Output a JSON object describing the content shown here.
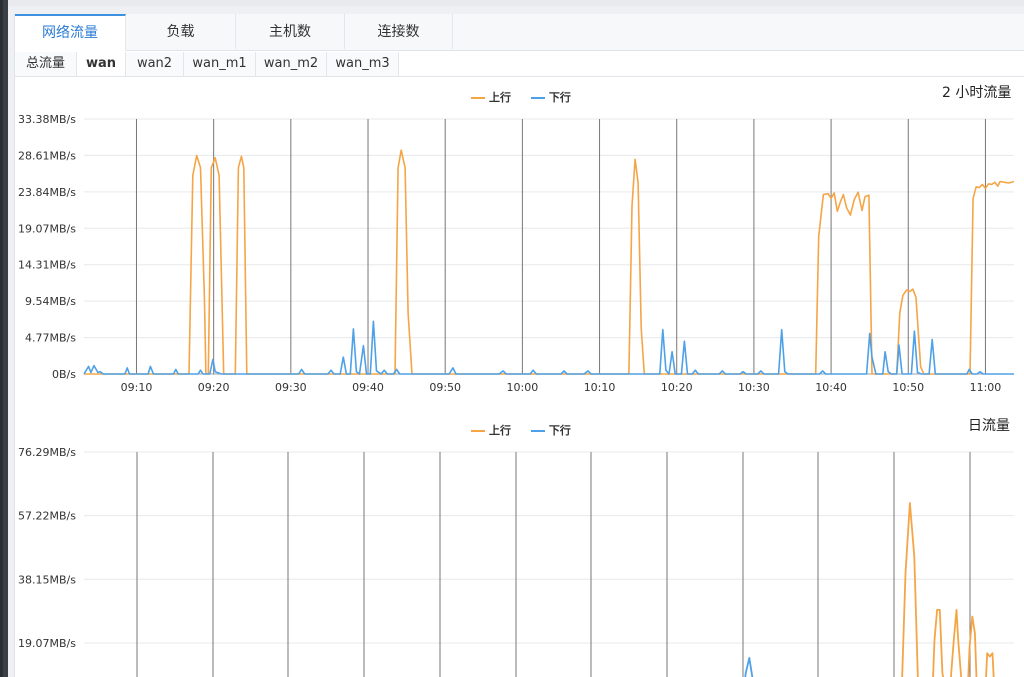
{
  "tabs": [
    "网络流量",
    "负载",
    "主机数",
    "连接数"
  ],
  "subtabs": [
    "总流量",
    "wan",
    "wan2",
    "wan_m1",
    "wan_m2",
    "wan_m3"
  ],
  "colors": {
    "up": "#f5a545",
    "down": "#4ea1e8",
    "accent": "#3d8fe0"
  },
  "legend": {
    "up": "上行",
    "down": "下行"
  },
  "chart_data": [
    {
      "type": "line",
      "title": "2 小时流量",
      "ylim": [
        0,
        33.38
      ],
      "y_ticks": [
        "0B/s",
        "4.77MB/s",
        "9.54MB/s",
        "14.31MB/s",
        "19.07MB/s",
        "23.84MB/s",
        "28.61MB/s",
        "33.38MB/s"
      ],
      "x_ticks": [
        "09:10",
        "09:20",
        "09:30",
        "09:40",
        "09:50",
        "10:00",
        "10:10",
        "10:20",
        "10:30",
        "10:40",
        "10:50",
        "11:00"
      ],
      "x_tick_minutes": [
        10,
        20,
        30,
        40,
        50,
        60,
        70,
        80,
        90,
        100,
        110,
        120
      ],
      "xlim_minutes": [
        3.2,
        123.7
      ],
      "series": [
        {
          "name": "上行",
          "color": "#f5a545",
          "x": [
            3.2,
            16.8,
            17.3,
            17.8,
            18.3,
            18.8,
            19.0,
            19.3,
            19.7,
            20.2,
            20.7,
            21.3,
            22.8,
            23.2,
            23.6,
            23.9,
            24.3,
            43.5,
            43.9,
            44.3,
            44.8,
            45.2,
            45.7,
            46.5,
            73.8,
            74.2,
            74.6,
            75.0,
            75.4,
            75.8,
            79.5,
            80.2,
            97.5,
            98.0,
            98.4,
            99.0,
            99.6,
            100.0,
            100.4,
            100.8,
            101.2,
            101.6,
            102.0,
            102.5,
            103.0,
            103.5,
            104.0,
            104.4,
            104.9,
            105.3,
            108.0,
            108.5,
            108.9,
            109.3,
            109.8,
            110.2,
            110.6,
            111.0,
            111.6,
            112.0,
            117.4,
            118.0,
            118.4,
            118.8,
            119.2,
            119.6,
            120.0,
            120.4,
            120.8,
            121.2,
            121.6,
            121.9,
            122.5,
            123.0,
            123.7
          ],
          "y": [
            0,
            0,
            26,
            28.6,
            27,
            10,
            0,
            0,
            27,
            28.3,
            26,
            0,
            0,
            27,
            28.5,
            27,
            0,
            0,
            27,
            29.3,
            27,
            8,
            0,
            0,
            0,
            22,
            28.1,
            25,
            6,
            0,
            0,
            0,
            0,
            0,
            18,
            23.5,
            23.6,
            23,
            23.7,
            21.3,
            22.5,
            23.5,
            21.8,
            20.8,
            22.8,
            23.8,
            21.4,
            23.2,
            23.4,
            0,
            0,
            0,
            8,
            10.3,
            11.0,
            10.8,
            11.1,
            10,
            1,
            0,
            0,
            0,
            23.0,
            24.5,
            24.4,
            24.8,
            24.3,
            24.9,
            24.8,
            25.1,
            24.6,
            25.2,
            25.1,
            25.0,
            25.2
          ]
        },
        {
          "name": "下行",
          "color": "#4ea1e8",
          "x": [
            3.2,
            3.8,
            4.1,
            4.5,
            5.0,
            5.3,
            5.7,
            6.2,
            8.5,
            8.8,
            9.1,
            11.5,
            11.8,
            12.2,
            14.8,
            15.1,
            15.4,
            18.0,
            18.3,
            18.6,
            19.5,
            19.9,
            20.2,
            21.0,
            31.0,
            31.4,
            31.8,
            34.8,
            35.2,
            35.6,
            36.4,
            36.8,
            37.2,
            37.7,
            38.1,
            38.5,
            38.9,
            39.4,
            39.8,
            40.3,
            40.7,
            41.1,
            41.7,
            42.1,
            42.5,
            43.3,
            43.7,
            44.1,
            50.5,
            51.0,
            51.4,
            57.0,
            57.5,
            57.9,
            61.0,
            61.4,
            61.8,
            65.0,
            65.4,
            65.8,
            68.0,
            68.5,
            68.9,
            77.8,
            78.2,
            78.6,
            79.0,
            79.4,
            79.8,
            80.6,
            81.0,
            81.4,
            82.0,
            82.4,
            82.8,
            85.5,
            85.9,
            86.3,
            88.2,
            88.6,
            89.0,
            90.5,
            90.9,
            91.3,
            93.2,
            93.6,
            94.0,
            94.4,
            98.5,
            98.9,
            99.3,
            104.6,
            105.0,
            105.3,
            105.8,
            106.7,
            107.0,
            107.4,
            107.8,
            108.5,
            108.8,
            109.2,
            109.7,
            110.4,
            110.8,
            111.2,
            111.7,
            112.7,
            113.1,
            113.5,
            113.9,
            117.6,
            117.9,
            118.3,
            118.9,
            119.3,
            119.7,
            123.7
          ],
          "y": [
            0,
            1.0,
            0.2,
            1.1,
            0.2,
            0.3,
            0,
            0,
            0,
            0.8,
            0,
            0,
            1.0,
            0,
            0,
            0.6,
            0,
            0,
            0.5,
            0,
            0,
            1.9,
            0.3,
            0,
            0,
            0.6,
            0,
            0,
            0.5,
            0,
            0,
            2.2,
            0,
            0,
            5.9,
            0.3,
            0,
            3.7,
            0,
            0,
            6.9,
            0.4,
            0,
            0.5,
            0,
            0,
            0.6,
            0,
            0,
            0.8,
            0,
            0,
            0.4,
            0,
            0,
            0.5,
            0,
            0,
            0.4,
            0,
            0,
            0.4,
            0,
            0,
            5.8,
            0.5,
            0,
            2.9,
            0,
            0,
            4.3,
            0,
            0,
            0.5,
            0,
            0,
            0.4,
            0,
            0,
            0.3,
            0,
            0,
            0.4,
            0,
            0,
            5.8,
            0.3,
            0,
            0,
            0.4,
            0,
            0,
            5.3,
            2.2,
            0,
            0,
            2.9,
            0.3,
            0,
            0,
            3.8,
            0,
            0,
            0,
            5.6,
            0.2,
            0,
            0,
            4.5,
            0,
            0,
            0,
            0.6,
            0,
            0,
            0.3,
            0,
            0
          ]
        }
      ]
    },
    {
      "type": "line",
      "title": "日流量",
      "ylim": [
        0,
        76.29
      ],
      "y_ticks": [
        "19.07MB/s",
        "38.15MB/s",
        "57.22MB/s",
        "76.29MB/s"
      ],
      "y_tick_values": [
        19.07,
        38.15,
        57.22,
        76.29
      ],
      "series": [
        {
          "name": "上行",
          "color": "#f5a545",
          "x": [
            0.0,
            0.76,
            0.925,
            0.93,
            0.935,
            0.94,
            0.945,
            0.95,
            0.96,
            0.963,
            0.966,
            0.969,
            0.972,
            0.98,
            0.982,
            0.985,
            0.988,
            0.99,
            0.996,
            1.0,
            1.003,
            1.006,
            1.009,
            1.012,
            1.02,
            1.023,
            1.026,
            1.029,
            1.032
          ],
          "y": [
            0,
            0,
            0,
            40,
            61,
            45,
            0,
            0,
            0,
            20,
            29,
            29,
            10,
            0,
            10,
            20,
            29,
            20,
            0,
            0,
            18,
            27,
            22,
            0,
            0,
            16,
            15,
            16,
            0
          ]
        },
        {
          "name": "下行",
          "color": "#4ea1e8",
          "x": [
            0.0,
            0.74,
            0.745,
            0.748,
            0.752,
            0.756,
            0.76,
            1.0
          ],
          "y": [
            0,
            0,
            3,
            10,
            14.6,
            8,
            0,
            0
          ]
        }
      ]
    }
  ]
}
